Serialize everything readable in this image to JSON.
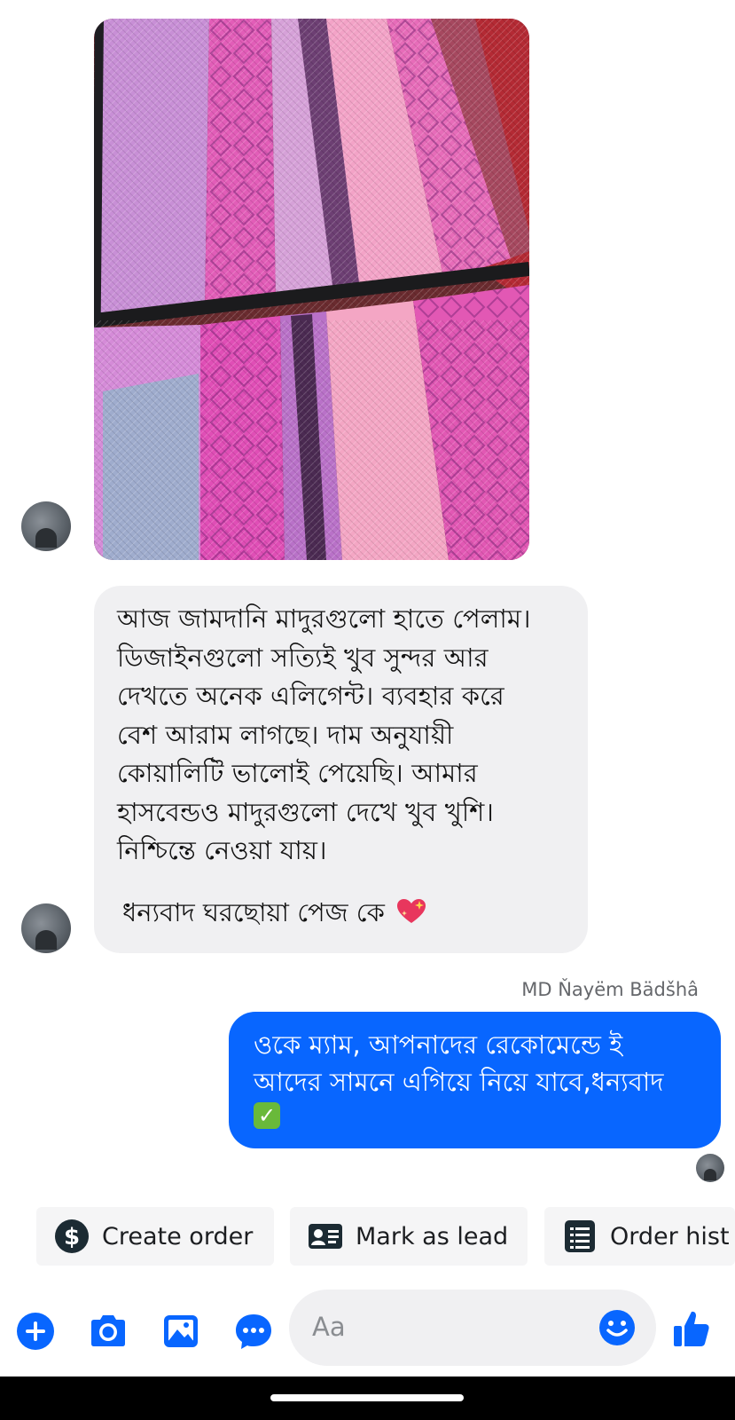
{
  "incoming_message": {
    "lines": [
      "আজ জামদানি মাদুরগুলো হাতে পেলাম।",
      "ডিজাইনগুলো সত্যিই খুব সুন্দর আর",
      "দেখতে অনেক এলিগেন্ট। ব্যবহার করে",
      "বেশ আরাম লাগছে। দাম অনুযায়ী",
      "কোয়ালিটি ভালোই পেয়েছি। আমার",
      "হাসবেন্ডও মাদুরগুলো দেখে খুব খুশি।",
      "নিশ্চিন্তে নেওয়া যায়।"
    ],
    "thanks": "ধন্যবাদ ঘরছোয়া পেজ কে",
    "emoji": "sparkling-heart"
  },
  "outgoing_message": {
    "sender_name": "MD Ňayëm Bädšhâ",
    "line1": "ওকে ম্যাম, আপনাদের রেকোমেন্ডে ই",
    "line2": "আদের সামনে এগিয়ে নিয়ে যাবে,ধন্যবাদ",
    "emoji": "check-mark-button"
  },
  "quick_actions": [
    {
      "label": "Create order",
      "icon": "dollar-icon"
    },
    {
      "label": "Mark as lead",
      "icon": "contact-card-icon"
    },
    {
      "label": "Order hist",
      "icon": "list-document-icon"
    }
  ],
  "composer": {
    "placeholder": "Aa",
    "icons": [
      "plus-icon",
      "camera-icon",
      "gallery-icon",
      "chat-bubble-icon",
      "emoji-icon",
      "thumbs-up-icon"
    ]
  },
  "colors": {
    "accent": "#0866ff",
    "incoming_bubble": "#f0f0f2",
    "outgoing_bubble": "#0866ff"
  }
}
